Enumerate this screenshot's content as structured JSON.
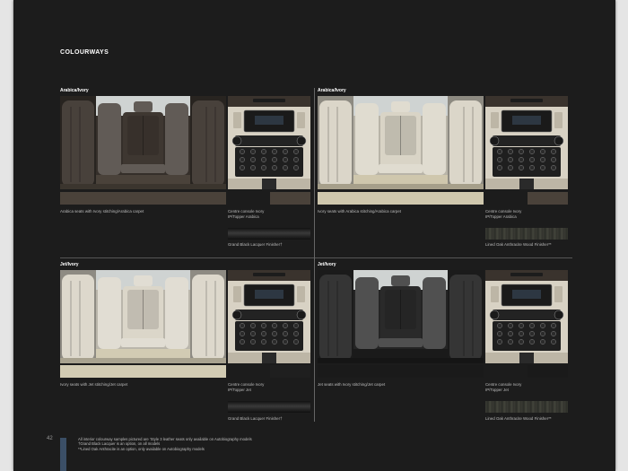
{
  "heading": "COLOURWAYS",
  "panels": [
    {
      "label": "Arabica/Ivory",
      "seat_caption": "Arabica seats with Ivory stitching/Arabica carpet",
      "console_caption": [
        "Centre console Ivory",
        "IP/Topper Arabica"
      ],
      "finish_caption": "Grand Black Lacquer Finisher†",
      "colors": {
        "seat": "#3e3731",
        "carpet": "#4a423a",
        "console_swatch": "#4a423a",
        "finish": "#2a2a2a"
      }
    },
    {
      "label": "Arabica/Ivory",
      "seat_caption": "Ivory seats with Arabica stitching/Arabica carpet",
      "console_caption": [
        "Centre console Ivory",
        "IP/Topper Arabica"
      ],
      "finish_caption": "Lined Oak Anthracite Wood Finisher**",
      "colors": {
        "seat": "#d9d4c6",
        "carpet": "#cfc7ad",
        "console_swatch": "#4a423a",
        "finish": "#353630"
      }
    },
    {
      "label": "Jet/Ivory",
      "seat_caption": "Ivory seats with Jet stitching/Jet carpet",
      "console_caption": [
        "Centre console Ivory",
        "IP/Topper Jet"
      ],
      "finish_caption": "Grand Black Lacquer Finisher†",
      "colors": {
        "seat": "#dbd6c9",
        "carpet": "#d2cbb3",
        "console_swatch": "#1f1f1f",
        "finish": "#2a2a2a"
      }
    },
    {
      "label": "Jet/Ivory",
      "seat_caption": "Jet seats with Ivory stitching/Jet carpet",
      "console_caption": [
        "Centre console Ivory",
        "IP/Topper Jet"
      ],
      "finish_caption": "Lined Oak Anthracite Wood Finisher**",
      "colors": {
        "seat": "#2a2a2a",
        "carpet": "#1a1a1a",
        "console_swatch": "#1a1a1a",
        "finish": "#353630"
      }
    }
  ],
  "page_number": "42",
  "footnotes": [
    "All interior colourway samples pictured are ‘Style 3 leather seats only available on Autobiography models",
    "†Grand Black Lacquer is an option, on all models",
    "**Lined Oak Anthracite is an option, only available on Autobiography models"
  ]
}
